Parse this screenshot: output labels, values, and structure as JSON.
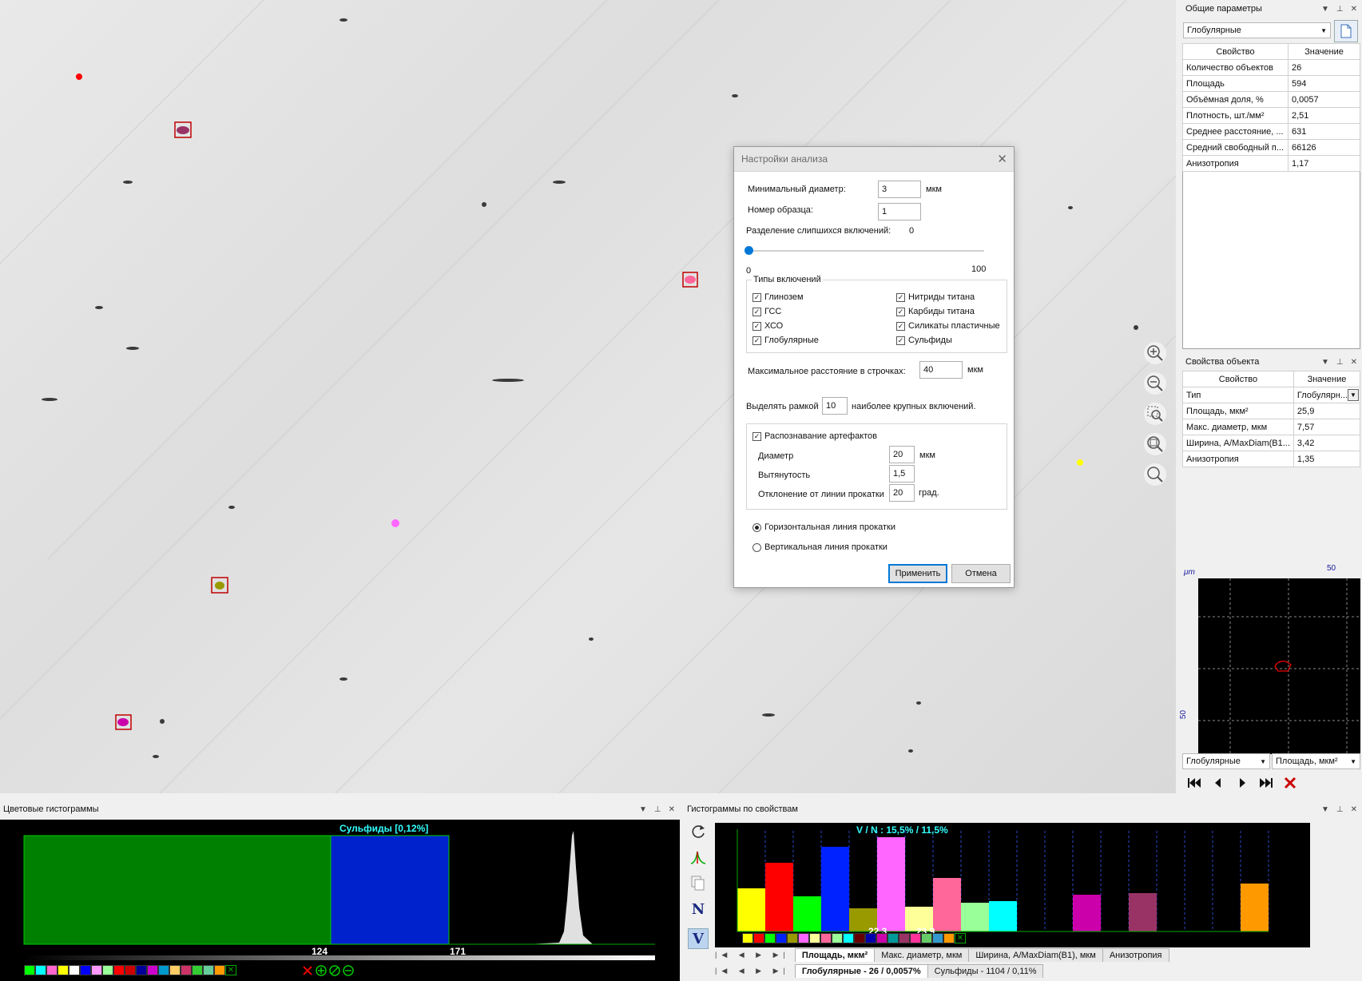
{
  "dialog": {
    "title": "Настройки анализа",
    "min_diameter_label": "Минимальный диаметр:",
    "min_diameter_value": "3",
    "unit_mkm": "мкм",
    "sample_number_label": "Номер образца:",
    "sample_number_value": "1",
    "separation_label": "Разделение слипшихся включений:",
    "separation_value": "0",
    "slider_min": "0",
    "slider_max": "100",
    "slider_level": 0,
    "types_group_label": "Типы включений",
    "types": [
      {
        "label": "Глинозем",
        "checked": true
      },
      {
        "label": "ГСС",
        "checked": true
      },
      {
        "label": "ХСО",
        "checked": true
      },
      {
        "label": "Глобулярные",
        "checked": true
      },
      {
        "label": "Нитриды титана",
        "checked": true
      },
      {
        "label": "Карбиды титана",
        "checked": true
      },
      {
        "label": "Силикаты пластичные",
        "checked": true
      },
      {
        "label": "Сульфиды",
        "checked": true
      }
    ],
    "max_distance_label": "Максимальное расстояние в строчках:",
    "max_distance_value": "40",
    "highlight_label_pre": "Выделять рамкой",
    "highlight_value": "10",
    "highlight_label_post": "наиболее крупных включений.",
    "artifacts_label": "Распознавание артефактов",
    "artifacts_checked": true,
    "diameter_label": "Диаметр",
    "diameter_value": "20",
    "elongation_label": "Вытянутость",
    "elongation_value": "1,5",
    "deviation_label": "Отклонение от линии прокатки",
    "deviation_value": "20",
    "unit_deg": "град.",
    "radio_horizontal": "Горизонтальная линия прокатки",
    "radio_vertical": "Вертикальная линия прокатки",
    "radio_selected": "horizontal",
    "apply_label": "Применить",
    "cancel_label": "Отмена"
  },
  "general_params": {
    "title": "Общие параметры",
    "selected": "Глобулярные",
    "col_property": "Свойство",
    "col_value": "Значение",
    "rows": [
      {
        "name": "Количество объектов",
        "value": "26"
      },
      {
        "name": "Площадь",
        "value": "594"
      },
      {
        "name": "Объёмная доля, %",
        "value": "0,0057"
      },
      {
        "name": "Плотность, шт./мм²",
        "value": "2,51"
      },
      {
        "name": "Среднее расстояние, ...",
        "value": "631"
      },
      {
        "name": "Средний свободный п...",
        "value": "66126"
      },
      {
        "name": "Анизотропия",
        "value": "1,17"
      }
    ]
  },
  "object_props": {
    "title": "Свойства объекта",
    "col_property": "Свойство",
    "col_value": "Значение",
    "rows": [
      {
        "name": "Тип",
        "value": "Глобулярн..."
      },
      {
        "name": "Площадь, мкм²",
        "value": "25,9"
      },
      {
        "name": "Макс. диаметр, мкм",
        "value": "7,57"
      },
      {
        "name": "Ширина, A/MaxDiam(B1...",
        "value": "3,42"
      },
      {
        "name": "Анизотропия",
        "value": "1,35"
      }
    ]
  },
  "preview": {
    "unit": "μm",
    "top_tick": "50",
    "left_tick": "50",
    "type_select": "Глобулярные",
    "prop_select": "Площадь, мкм²"
  },
  "color_hist": {
    "title": "Цветовые гистограммы",
    "label": "Сульфиды [0,12%]",
    "left_value": "124",
    "right_value": "171",
    "swatches": [
      "#00ff00",
      "#00ffff",
      "#ff66cc",
      "#ffff00",
      "#ffffff",
      "#0000ff",
      "#ff99ff",
      "#99ff99",
      "#ff0000",
      "#cc0000",
      "#000099",
      "#cc00cc",
      "#0099cc",
      "#ffcc66",
      "#cc3366",
      "#33cc33",
      "#66cc99",
      "#ff9900"
    ]
  },
  "prop_hist": {
    "title": "Гистограммы по свойствам",
    "label": "V / N : 15,5% / 11,5%",
    "value_a": "22,3",
    "value_b": "23,9",
    "bars": [
      {
        "color": "#ffff00",
        "level": 0.45
      },
      {
        "color": "#ff0000",
        "level": 0.72
      },
      {
        "color": "#00ff00",
        "level": 0.37
      },
      {
        "color": "#0022ff",
        "level": 0.88
      },
      {
        "color": "#999900",
        "level": 0.24
      },
      {
        "color": "#ff66ff",
        "level": 0.98
      },
      {
        "color": "#ffff99",
        "level": 0.26
      },
      {
        "color": "#ff6699",
        "level": 0.56
      },
      {
        "color": "#99ff99",
        "level": 0.3
      },
      {
        "color": "#00ffff",
        "level": 0.32
      },
      {
        "color": "#000000",
        "level": 0
      },
      {
        "color": "#000000",
        "level": 0
      },
      {
        "color": "#cc00aa",
        "level": 0.38
      },
      {
        "color": "#000000",
        "level": 0
      },
      {
        "color": "#993366",
        "level": 0.4
      },
      {
        "color": "#000000",
        "level": 0
      },
      {
        "color": "#000000",
        "level": 0
      },
      {
        "color": "#000000",
        "level": 0
      },
      {
        "color": "#ff9900",
        "level": 0.5
      }
    ],
    "swatches": [
      "#ffff00",
      "#ff0000",
      "#00ff00",
      "#0022ff",
      "#999900",
      "#ff66ff",
      "#ffff99",
      "#ff6699",
      "#99ff99",
      "#00ffff",
      "#660000",
      "#0000aa",
      "#cc00aa",
      "#009999",
      "#993366",
      "#ff3399",
      "#66cc66",
      "#3399cc",
      "#ff9900"
    ],
    "tabs": [
      "Площадь, мкм²",
      "Макс. диаметр, мкм",
      "Ширина, A/MaxDiam(B1), мкм",
      "Анизотропия"
    ],
    "bottom_tabs": [
      "Глобулярные - 26 / 0,0057%",
      "Сульфиды - 1104 / 0,11%"
    ],
    "btn_n": "N",
    "btn_v": "V"
  }
}
